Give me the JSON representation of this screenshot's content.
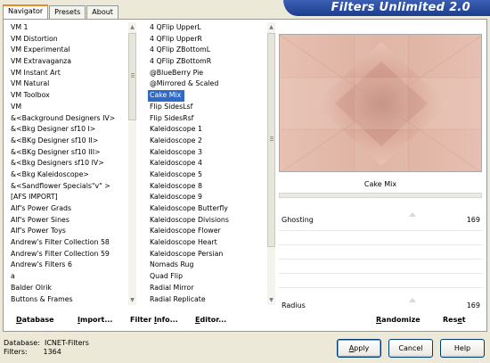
{
  "tabs": [
    "Navigator",
    "Presets",
    "About"
  ],
  "banner_title": "Filters Unlimited 2.0",
  "categories": [
    "VM 1",
    "VM Distortion",
    "VM Experimental",
    "VM Extravaganza",
    "VM Instant Art",
    "VM Natural",
    "VM Toolbox",
    "VM",
    "&<Background Designers IV>",
    "&<Bkg Designer sf10 I>",
    "&<BKg Designer sf10 II>",
    "&<BKg Designer sf10 III>",
    "&<Bkg Designers sf10 IV>",
    "&<Bkg Kaleidoscope>",
    "&<Sandflower Specials\"v\" >",
    "[AFS IMPORT]",
    "Alf's Power Grads",
    "Alf's Power Sines",
    "Alf's Power Toys",
    "Andrew's Filter Collection 58",
    "Andrew's Filter Collection 59",
    "Andrew's Filters 6",
    "a",
    "Balder Olrik",
    "Buttons & Frames"
  ],
  "filters": [
    "4 QFlip UpperL",
    "4 QFlip UpperR",
    "4 QFlip ZBottomL",
    "4 QFlip ZBottomR",
    "@BlueBerry Pie",
    "@Mirrored & Scaled",
    "Cake Mix",
    "Flip SidesLsf",
    "Flip SidesRsf",
    "Kaleidoscope 1",
    "Kaleidoscope 2",
    "Kaleidoscope 3",
    "Kaleidoscope 4",
    "Kaleidoscope 5",
    "Kaleidoscope 8",
    "Kaleidoscope 9",
    "Kaleidoscope Butterfly",
    "Kaleidoscope Divisions",
    "Kaleidoscope Flower",
    "Kaleidoscope Heart",
    "Kaleidoscope Persian",
    "Nomads Rug",
    "Quad Flip",
    "Radial Mirror",
    "Radial Replicate"
  ],
  "selected_filter": "Cake Mix",
  "filter_name": "Cake Mix",
  "params": {
    "ghosting": {
      "label": "Ghosting",
      "value": "169"
    },
    "radius": {
      "label": "Radius",
      "value": "169"
    }
  },
  "bottom_buttons": {
    "database": {
      "u": "D",
      "rest": "atabase"
    },
    "import": {
      "u": "I",
      "rest": "mport..."
    },
    "filter_info": {
      "pre": "Filter ",
      "u": "I",
      "rest": "nfo..."
    },
    "editor": {
      "u": "E",
      "rest": "ditor..."
    },
    "randomize": {
      "u": "R",
      "rest": "andomize"
    },
    "reset": {
      "pre": "Res",
      "u": "e",
      "rest": "t"
    }
  },
  "info": {
    "database_label": "Database:",
    "database_value": "ICNET-Filters",
    "filters_label": "Filters:",
    "filters_value": "1364"
  },
  "dialog_buttons": {
    "apply": {
      "u": "A",
      "rest": "pply"
    },
    "cancel": "Cancel",
    "help": "Help"
  },
  "colors": {
    "selection": "#3169c6",
    "banner": "#2a4fa6",
    "preview_base": "#e2b5a5"
  }
}
